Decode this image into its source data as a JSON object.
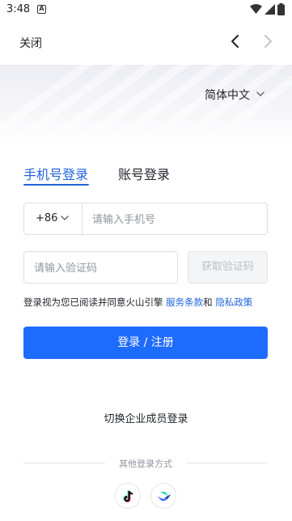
{
  "status_bar": {
    "time": "3:48",
    "notification_letter": "A"
  },
  "nav": {
    "close_label": "关闭"
  },
  "language": {
    "selected": "简体中文"
  },
  "tabs": [
    {
      "label": "手机号登录",
      "active": true
    },
    {
      "label": "账号登录",
      "active": false
    }
  ],
  "phone": {
    "country_code": "+86",
    "placeholder": "请输入手机号",
    "value": ""
  },
  "code": {
    "placeholder": "请输入验证码",
    "value": "",
    "get_code_label": "获取验证码"
  },
  "agreement": {
    "prefix": "登录视为您已阅读并同意火山引擎 ",
    "terms": "服务条款",
    "middle": "和 ",
    "privacy": "隐私政策"
  },
  "login_button": "登录 / 注册",
  "enterprise_login": "切换企业成员登录",
  "other_methods_label": "其他登录方式",
  "colors": {
    "accent": "#1e6bff",
    "link": "#1f63d8",
    "disabled_text": "#bbbfc4"
  },
  "icons": [
    "wifi-icon",
    "signal-icon",
    "battery-icon",
    "back-arrow-icon",
    "forward-arrow-icon",
    "chevron-down-icon",
    "tiktok-icon",
    "lark-icon"
  ]
}
